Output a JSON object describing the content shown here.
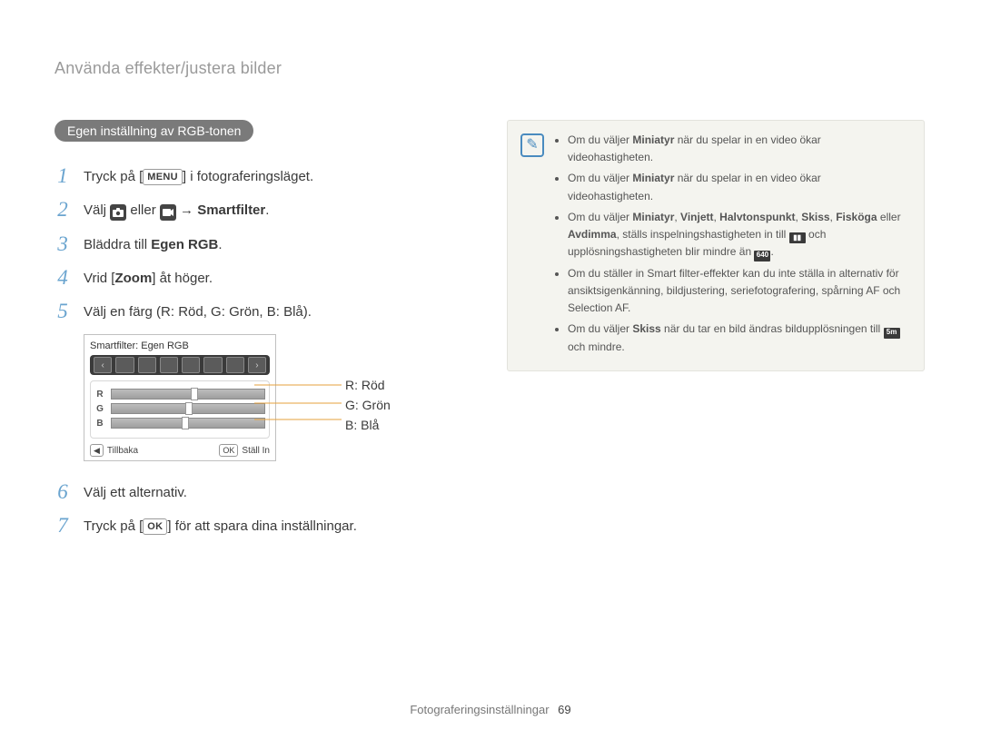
{
  "header": {
    "title": "Använda effekter/justera bilder"
  },
  "section": {
    "title": "Egen inställning av RGB-tonen"
  },
  "steps": {
    "s1_a": "Tryck på [",
    "s1_menu": "MENU",
    "s1_b": "] i fotograferingsläget.",
    "s2_a": "Välj ",
    "s2_b": " eller ",
    "s2_c": " → ",
    "s2_bold": "Smartfilter",
    "s2_d": ".",
    "s3_a": "Bläddra till ",
    "s3_bold": "Egen RGB",
    "s3_b": ".",
    "s4_a": "Vrid [",
    "s4_bold": "Zoom",
    "s4_b": "] åt höger.",
    "s5": "Välj en färg (R: Röd, G: Grön, B: Blå).",
    "s6": "Välj ett alternativ.",
    "s7_a": "Tryck på [",
    "s7_ok": "OK",
    "s7_b": "] för att spara dina inställningar."
  },
  "device": {
    "title": "Smartfilter: Egen RGB",
    "r": "R",
    "g": "G",
    "b": "B",
    "back_key": "◀",
    "back": "Tillbaka",
    "set_key": "OK",
    "set": "Ställ In"
  },
  "annotations": {
    "r": "R: Röd",
    "g": "G: Grön",
    "b": "B: Blå"
  },
  "notes": {
    "b1_a": "Om du väljer ",
    "b1_kw": "Miniatyr",
    "b1_b": " när du spelar in en video ökar videohastigheten.",
    "b2_a": "Om du väljer ",
    "b2_kw": "Miniatyr",
    "b2_b": " när du spelar in en video ökar videohastigheten.",
    "b3_a": "Om du väljer ",
    "b3_k1": "Miniatyr",
    "b3_s": ", ",
    "b3_k2": "Vinjett",
    "b3_k3": "Halvtonspunkt",
    "b3_k4": "Skiss",
    "b3_k5": "Fisköga",
    "b3_b": " eller ",
    "b3_k6": "Avdimma",
    "b3_c": ", ställs inspelningshastigheten in till ",
    "b3_d": " och upplösningshastigheten blir mindre än ",
    "b3_icon": "640",
    "b3_e": ".",
    "b4": "Om du ställer in Smart filter-effekter kan du inte ställa in alternativ för ansiktsigenkänning, bildjustering, seriefotografering, spårning AF och Selection AF.",
    "b5_a": "Om du väljer ",
    "b5_kw": "Skiss",
    "b5_b": " när du tar en bild ändras bildupplösningen till ",
    "b5_icon": "5m",
    "b5_c": " och mindre."
  },
  "footer": {
    "label": "Fotograferingsinställningar",
    "page": "69"
  }
}
